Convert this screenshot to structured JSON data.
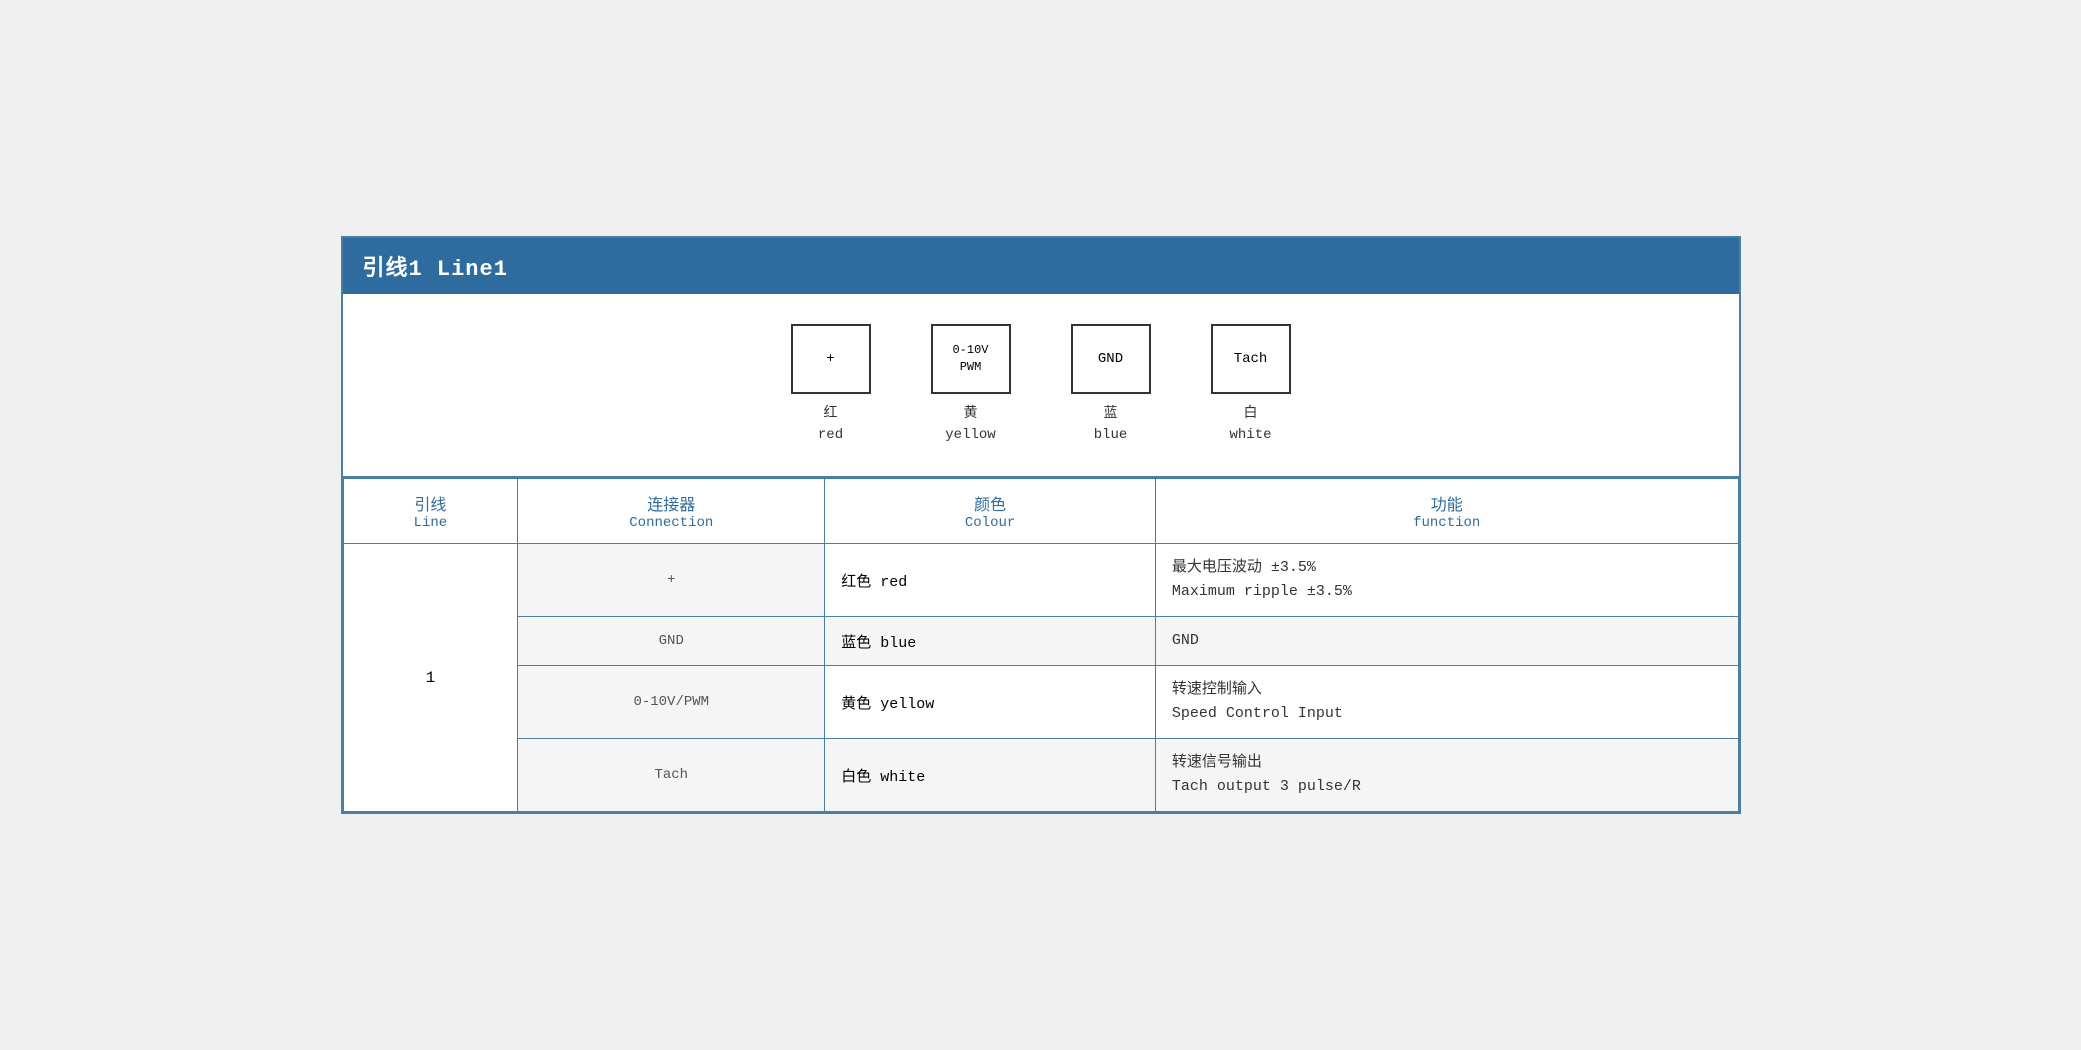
{
  "header": {
    "title": "引线1 Line1"
  },
  "connectors": [
    {
      "symbol": "+",
      "zh_label": "红",
      "en_label": "red"
    },
    {
      "symbol": "0-10V\nPWM",
      "zh_label": "黄",
      "en_label": "yellow"
    },
    {
      "symbol": "GND",
      "zh_label": "蓝",
      "en_label": "blue"
    },
    {
      "symbol": "Tach",
      "zh_label": "白",
      "en_label": "white"
    }
  ],
  "table": {
    "headers": [
      {
        "zh": "引线",
        "en": "Line"
      },
      {
        "zh": "连接器",
        "en": "Connection"
      },
      {
        "zh": "颜色",
        "en": "Colour"
      },
      {
        "zh": "功能",
        "en": "function"
      }
    ],
    "rows": [
      {
        "line": "1",
        "connection": "+",
        "colour_zh": "红色",
        "colour_en": "red",
        "function_zh": "最大电压波动 ±3.5%",
        "function_en": "Maximum ripple ±3.5%",
        "rowspan": 4
      },
      {
        "line": "",
        "connection": "GND",
        "colour_zh": "蓝色",
        "colour_en": "blue",
        "function_zh": "GND",
        "function_en": ""
      },
      {
        "line": "",
        "connection": "0-10V/PWM",
        "colour_zh": "黄色",
        "colour_en": "yellow",
        "function_zh": "转速控制输入",
        "function_en": "Speed Control Input"
      },
      {
        "line": "",
        "connection": "Tach",
        "colour_zh": "白色",
        "colour_en": "white",
        "function_zh": "转速信号输出",
        "function_en": "Tach output 3 pulse/R"
      }
    ]
  }
}
